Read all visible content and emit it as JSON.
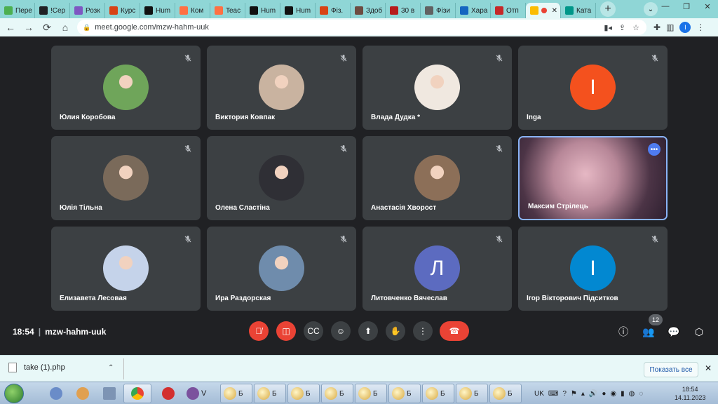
{
  "browser": {
    "tabs": [
      {
        "label": "Пере",
        "color": "#4caf50"
      },
      {
        "label": "!Сер",
        "color": "#202124"
      },
      {
        "label": "Розк",
        "color": "#7e57c2"
      },
      {
        "label": "Курс",
        "color": "#d84315"
      },
      {
        "label": "Hum",
        "color": "#111111"
      },
      {
        "label": "Ком",
        "color": "#ff7043"
      },
      {
        "label": "Teac",
        "color": "#ff7043"
      },
      {
        "label": "Hum",
        "color": "#111111"
      },
      {
        "label": "Hum",
        "color": "#111111"
      },
      {
        "label": "Фіз.",
        "color": "#d84315"
      },
      {
        "label": "Здоб",
        "color": "#6d4c41"
      },
      {
        "label": "30 в",
        "color": "#b71c1c"
      },
      {
        "label": "Фізи",
        "color": "#616161"
      },
      {
        "label": "Хара",
        "color": "#1565c0"
      },
      {
        "label": "Отп",
        "color": "#c62828"
      },
      {
        "label": "",
        "color": "#fbbc04",
        "active": true
      },
      {
        "label": "Ката",
        "color": "#009688"
      }
    ],
    "url": "meet.google.com/mzw-hahm-uuk",
    "profile_initial": "I"
  },
  "participants": [
    {
      "name": "Юлия Коробова",
      "type": "photo",
      "color": "#6fa55a"
    },
    {
      "name": "Виктория Ковпак",
      "type": "photo",
      "color": "#c9b3a0"
    },
    {
      "name": "Влада Дудка *",
      "type": "photo",
      "color": "#f0e8e0"
    },
    {
      "name": "Inga",
      "type": "letter",
      "letter": "I",
      "color": "#f4511e"
    },
    {
      "name": "Юлія Тільна",
      "type": "photo",
      "color": "#7a6a5a"
    },
    {
      "name": "Олена Сластіна",
      "type": "photo",
      "color": "#2f2f35"
    },
    {
      "name": "Анастасія Хворост",
      "type": "photo",
      "color": "#8c6f58"
    },
    {
      "name": "Максим Стрілець",
      "type": "video",
      "color": "#b78798"
    },
    {
      "name": "Елизавета Лесовая",
      "type": "photo",
      "color": "#c5d3ea"
    },
    {
      "name": "Ира Раздорская",
      "type": "photo",
      "color": "#6f8cac"
    },
    {
      "name": "Литовченко Вячеслав",
      "type": "letter",
      "letter": "Л",
      "color": "#5c6bc0"
    },
    {
      "name": "Ігор Вікторович Підситков",
      "type": "letter",
      "letter": "І",
      "color": "#0288d1"
    }
  ],
  "meeting": {
    "time": "18:54",
    "code": "mzw-hahm-uuk",
    "participant_count": "12"
  },
  "downloads": {
    "file": "take (1).php",
    "show_all": "Показать все"
  },
  "taskbar": {
    "windows": [
      "Б",
      "Б",
      "Б",
      "Б",
      "Б",
      "Б",
      "Б",
      "Б",
      "Б"
    ],
    "viber_label": "V",
    "language": "UK",
    "time": "18:54",
    "date": "14.11.2023"
  }
}
